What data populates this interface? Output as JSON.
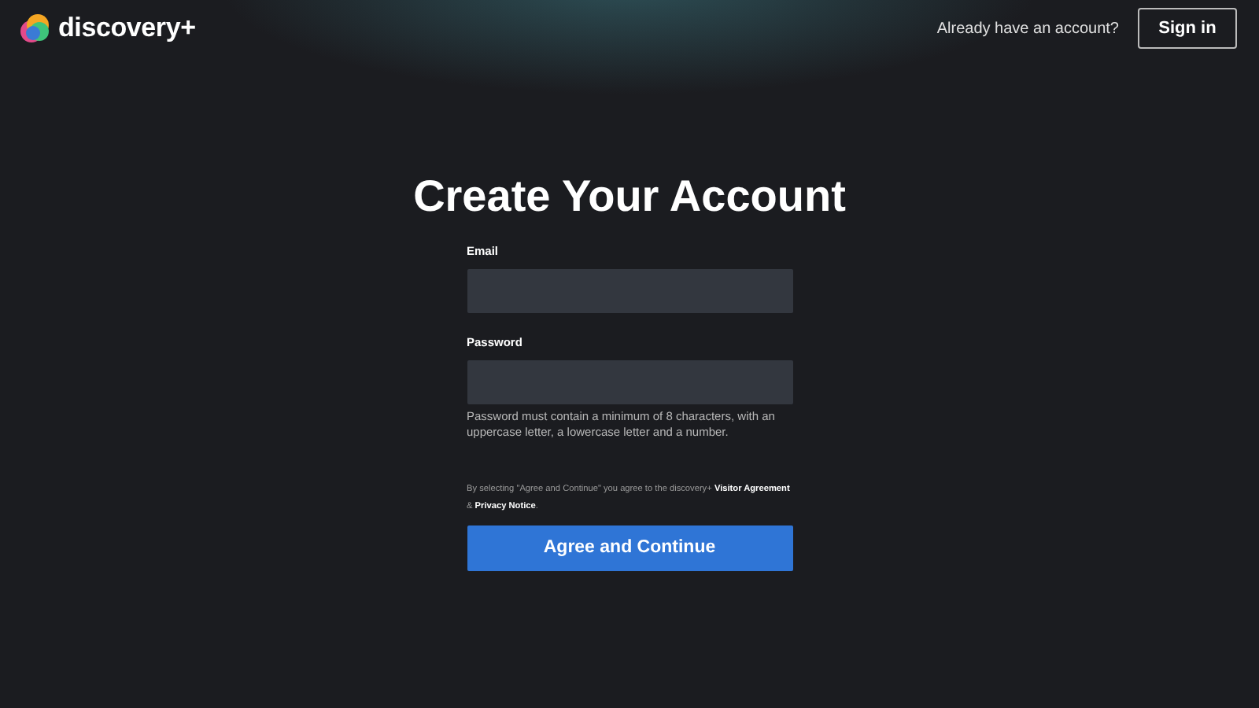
{
  "header": {
    "logo_text": "discovery+",
    "prompt": "Already have an account?",
    "sign_in": "Sign in"
  },
  "title": "Create Your Account",
  "fields": [
    {
      "label": "Email"
    },
    {
      "label": "Password",
      "hint": "Password must contain a minimum of 8 characters, with an uppercase letter, a lowercase letter and a number."
    }
  ],
  "legal": [
    {
      "kind": "text",
      "text": "By selecting \"Agree and Continue\" you agree to the discovery+ "
    },
    {
      "kind": "link",
      "text": "Visitor Agreement"
    },
    {
      "kind": "text",
      "text": " & "
    },
    {
      "kind": "link",
      "text": "Privacy Notice"
    },
    {
      "kind": "text",
      "text": "."
    }
  ],
  "submit": "Agree and Continue"
}
